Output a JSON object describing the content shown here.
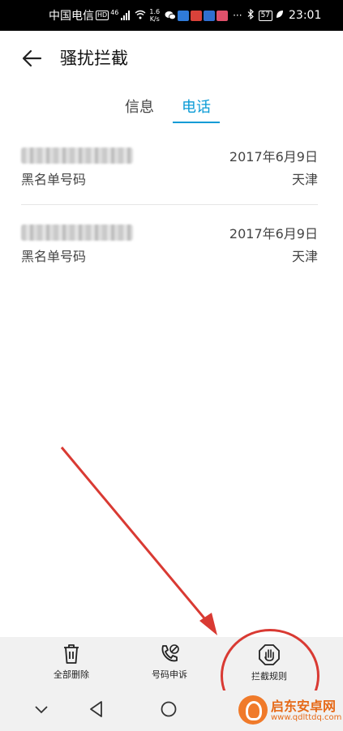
{
  "status_bar": {
    "carrier": "中国电信",
    "hd": "HD",
    "signal_type": "46",
    "speed_value": "1.6",
    "speed_unit": "K/s",
    "more": "···",
    "battery": "57",
    "time": "23:01"
  },
  "header": {
    "title": "骚扰拦截"
  },
  "tabs": [
    {
      "label": "信息"
    },
    {
      "label": "电话"
    }
  ],
  "active_tab": "电话",
  "calls": [
    {
      "date": "2017年6月9日",
      "type": "黑名单号码",
      "location": "天津"
    },
    {
      "date": "2017年6月9日",
      "type": "黑名单号码",
      "location": "天津"
    }
  ],
  "actions": {
    "delete_all": "全部删除",
    "appeal": "号码申诉",
    "rules": "拦截规则"
  },
  "watermark": {
    "name": "启东安卓网",
    "url": "www.qdlttdq.com"
  },
  "colors": {
    "accent": "#0a9bd6",
    "annotation_red": "#d93a33"
  }
}
